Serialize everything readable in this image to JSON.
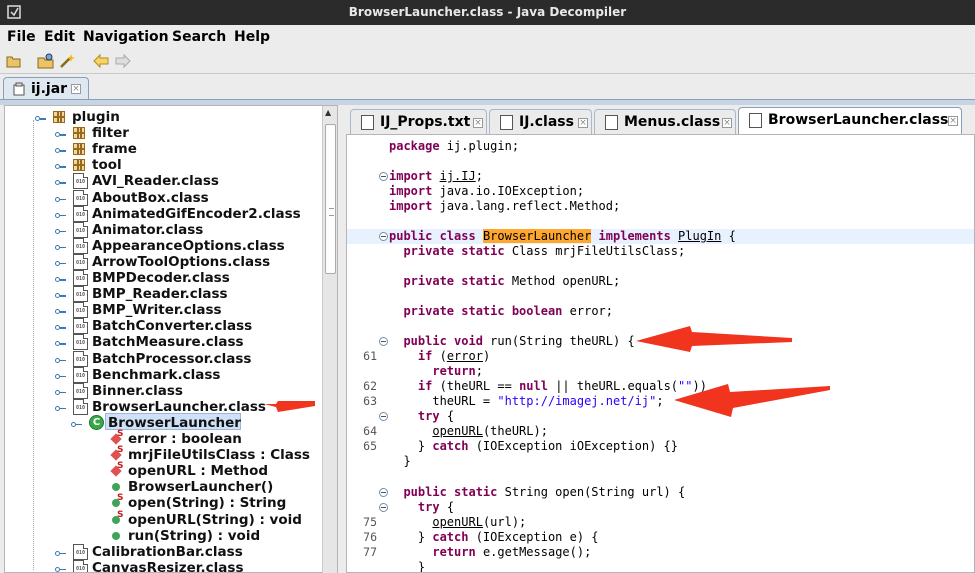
{
  "window": {
    "title": "BrowserLauncher.class - Java Decompiler"
  },
  "menu": {
    "file": "File",
    "edit": "Edit",
    "navigation": "Navigation",
    "search": "Search",
    "help": "Help"
  },
  "outer_tab": {
    "label": "ij.jar"
  },
  "tree": {
    "root": "plugin",
    "packages": [
      "filter",
      "frame",
      "tool"
    ],
    "classes": [
      "AVI_Reader.class",
      "AboutBox.class",
      "AnimatedGifEncoder2.class",
      "Animator.class",
      "AppearanceOptions.class",
      "ArrowToolOptions.class",
      "BMPDecoder.class",
      "BMP_Reader.class",
      "BMP_Writer.class",
      "BatchConverter.class",
      "BatchMeasure.class",
      "BatchProcessor.class",
      "Benchmark.class",
      "Binner.class",
      "BrowserLauncher.class"
    ],
    "selected_class": "BrowserLauncher",
    "members": [
      "error : boolean",
      "mrjFileUtilsClass : Class",
      "openURL : Method",
      "BrowserLauncher()",
      "open(String) : String",
      "openURL(String) : void",
      "run(String) : void"
    ],
    "after": [
      "CalibrationBar.class",
      "CanvasResizer.class"
    ]
  },
  "editor_tabs": [
    {
      "label": "IJ_Props.txt"
    },
    {
      "label": "IJ.class"
    },
    {
      "label": "Menus.class"
    },
    {
      "label": "BrowserLauncher.class",
      "active": true
    }
  ],
  "code": {
    "l_package": "package ij.plugin;",
    "imp1": "ij.IJ",
    "imp2": "java.io.IOException;",
    "imp3": "java.lang.reflect.Method;",
    "cls_name": "BrowserLauncher",
    "iface": "PlugIn",
    "field1": "Class mrjFileUtilsClass;",
    "field2": "Method openURL;",
    "field3": "error;",
    "run_sig": "run(String theURL) {",
    "url": "\"http://imagej.net/ij\"",
    "open_sig": "String open(String url) {",
    "line_numbers": [
      "61",
      "62",
      "63",
      "64",
      "65",
      "75",
      "76",
      "77"
    ]
  },
  "colors": {
    "keyword": "#7f0055",
    "string": "#2a00ff",
    "highlight": "#ffa62f",
    "arrow": "#f0341e",
    "titlebar": "#2b2b2b"
  }
}
